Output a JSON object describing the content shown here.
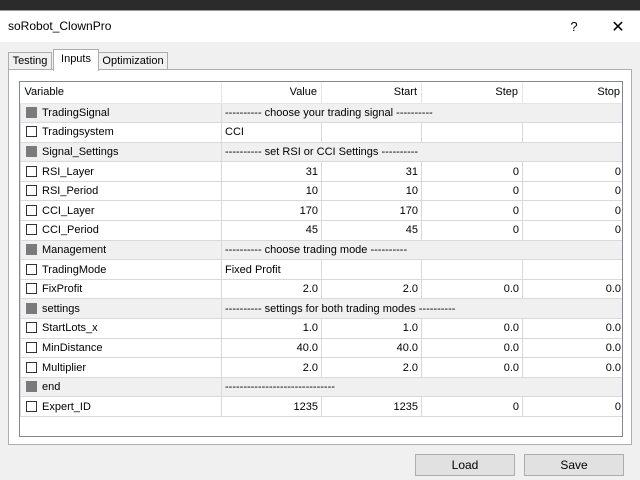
{
  "window": {
    "title": "soRobot_ClownPro",
    "help_glyph": "?",
    "close_glyph": "✕"
  },
  "tabs": [
    {
      "label": "Testing",
      "active": false
    },
    {
      "label": "Inputs",
      "active": true
    },
    {
      "label": "Optimization",
      "active": false
    }
  ],
  "table": {
    "headers": {
      "variable": "Variable",
      "value": "Value",
      "start": "Start",
      "step": "Step",
      "stop": "Stop"
    },
    "rows": [
      {
        "sep": true,
        "name": "TradingSignal",
        "text": "---------- choose your trading signal ----------"
      },
      {
        "sep": false,
        "name": "Tradingsystem",
        "value": "CCI",
        "start": "",
        "step": "",
        "stop": "",
        "text_value": true
      },
      {
        "sep": true,
        "name": "Signal_Settings",
        "text": "---------- set RSI or CCI Settings ----------"
      },
      {
        "sep": false,
        "name": "RSI_Layer",
        "value": "31",
        "start": "31",
        "step": "0",
        "stop": "0"
      },
      {
        "sep": false,
        "name": "RSI_Period",
        "value": "10",
        "start": "10",
        "step": "0",
        "stop": "0"
      },
      {
        "sep": false,
        "name": "CCI_Layer",
        "value": "170",
        "start": "170",
        "step": "0",
        "stop": "0"
      },
      {
        "sep": false,
        "name": "CCI_Period",
        "value": "45",
        "start": "45",
        "step": "0",
        "stop": "0"
      },
      {
        "sep": true,
        "name": "Management",
        "text": "---------- choose trading mode ----------"
      },
      {
        "sep": false,
        "name": "TradingMode",
        "value": "Fixed Profit",
        "start": "",
        "step": "",
        "stop": "",
        "text_value": true
      },
      {
        "sep": false,
        "name": "FixProfit",
        "value": "2.0",
        "start": "2.0",
        "step": "0.0",
        "stop": "0.0"
      },
      {
        "sep": true,
        "name": "settings",
        "text": "---------- settings for both trading modes ----------"
      },
      {
        "sep": false,
        "name": "StartLots_x",
        "value": "1.0",
        "start": "1.0",
        "step": "0.0",
        "stop": "0.0"
      },
      {
        "sep": false,
        "name": "MinDistance",
        "value": "40.0",
        "start": "40.0",
        "step": "0.0",
        "stop": "0.0"
      },
      {
        "sep": false,
        "name": "Multiplier",
        "value": "2.0",
        "start": "2.0",
        "step": "0.0",
        "stop": "0.0"
      },
      {
        "sep": true,
        "name": "end",
        "text": "------------------------------"
      },
      {
        "sep": false,
        "name": "Expert_ID",
        "value": "1235",
        "start": "1235",
        "step": "0",
        "stop": "0"
      }
    ]
  },
  "buttons": {
    "load": "Load",
    "save": "Save"
  }
}
